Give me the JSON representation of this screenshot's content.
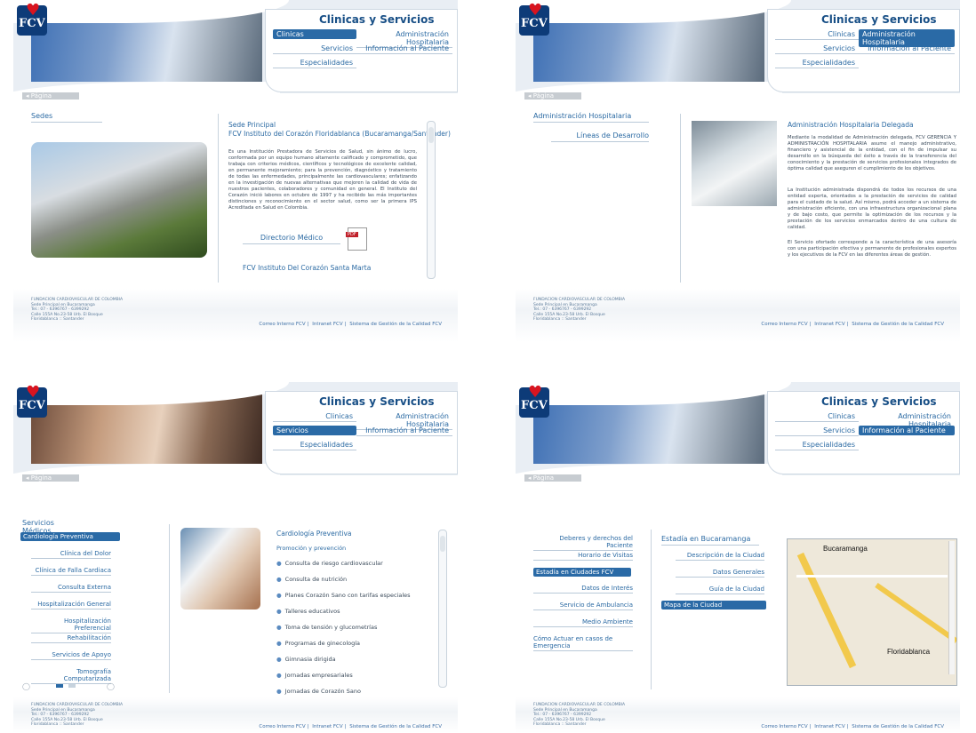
{
  "common": {
    "logo_text": "FCV",
    "menu_title": "Clinicas y Servicios",
    "menu": {
      "clinicas": "Clinicas",
      "administracion": "Administración Hospitalaria",
      "servicios": "Servicios",
      "informacion": "Información al Paciente",
      "especialidades": "Especialidades"
    },
    "pagina": "Página",
    "footer_address": [
      "FUNDACION CARDIOVASCULAR DE COLOMBIA",
      "Sede Principal en Bucaramanga",
      "Tel.: 07 - 6396767 - 6399292",
      "Calle 155A No.23-58 Urb. El Bosque",
      "Floridablanca :: Santander"
    ],
    "footer_links": [
      "Correo Interno FCV",
      "Intranet FCV",
      "Sistema de Gestión de la Calidad FCV"
    ]
  },
  "panel1": {
    "section": "Sedes",
    "title1": "Sede Principal",
    "title2": "FCV Instituto del Corazón Floridablanca (Bucaramanga/Santander)",
    "body": "Es una Institución Prestadora de Servicios de Salud, sin ánimo de lucro, conformada por un equipo humano altamente calificado y comprometido, que trabaja con criterios médicos, científicos y tecnológicos de excelente calidad, en permanente mejoramiento; para la prevención, diagnóstico y tratamiento de todas las enfermedades, principalmente las cardiovasculares; enfatizando en la investigación de nuevas alternativas que mejoren la calidad de vida de nuestros pacientes, colaboradores y comunidad en general. El Instituto del Corazón inició labores en octubre de 1997 y ha recibido las más importantes distinciones y reconocimiento en el sector salud, como ser la primera IPS Acreditada en Salud en Colombia.",
    "directorio": "Directorio Médico",
    "pdf": "PDF",
    "next": "FCV Instituto Del Corazón Santa Marta"
  },
  "panel2": {
    "section": "Administración Hospitalaria",
    "sub": "Líneas de Desarrollo",
    "title": "Administración Hospitalaria Delegada",
    "p1": "Mediante la modalidad de Administración delegada, FCV GERENCIA Y ADMINISTRACIÓN HOSPITALARIA asume el manejo administrativo, financiero y asistencial de la entidad, con el fin de impulsar su desarrollo en la búsqueda del éxito a través de la transferencia del conocimiento y la prestación de servicios profesionales integrados de óptima calidad que aseguren el cumplimiento de los objetivos.",
    "p2": "La Institución administrada dispondrá de todos los recursos de una entidad experta, orientados a la prestación de servicios de calidad para el cuidado de la salud. Así mismo, podrá acceder a un sistema de administración eficiente, con una infraestructura organizacional plana y de bajo costo, que permite la optimización de los recursos y la prestación de los servicios enmarcados dentro de una cultura de calidad.",
    "p3": "El Servicio ofertado corresponde a la característica de una asesoría con una participación efectiva y permanente de profesionales expertos y los ejecutivos de la FCV en las diferentes áreas de gestión."
  },
  "panel3": {
    "section": "Servicios Médicos",
    "items": [
      "Cardiología Preventiva",
      "Clínica del Dolor",
      "Clínica de Falla Cardiaca",
      "Consulta Externa",
      "Hospitalización General",
      "Hospitalización Preferencial",
      "Rehabilitación",
      "Servicios de Apoyo",
      "Tomografía Computarizada"
    ],
    "title": "Cardiología Preventiva",
    "subtitle": "Promoción y prevención",
    "bullets": [
      "Consulta de riesgo cardiovascular",
      "Consulta de nutrición",
      "Planes Corazón Sano con tarifas especiales",
      "Talleres educativos",
      "Toma de tensión y glucometrías",
      "Programas de ginecología",
      "Gimnasia dirigida",
      "Jornadas empresariales",
      "Jornadas de Corazón Sano"
    ]
  },
  "panel4": {
    "left_items": [
      "Deberes y derechos del Paciente",
      "Horario de Visitas",
      "Estadía en Ciudades FCV",
      "Datos de Interés",
      "Servicio de Ambulancia",
      "Medio Ambiente",
      "Cómo Actuar en casos de Emergencia"
    ],
    "mid_title": "Estadía en Bucaramanga",
    "mid_items": [
      "Descripción de la Ciudad",
      "Datos Generales",
      "Guía de la Ciudad",
      "Mapa de la Ciudad"
    ],
    "map_labels": [
      "Bucaramanga",
      "Floridablanca"
    ]
  }
}
